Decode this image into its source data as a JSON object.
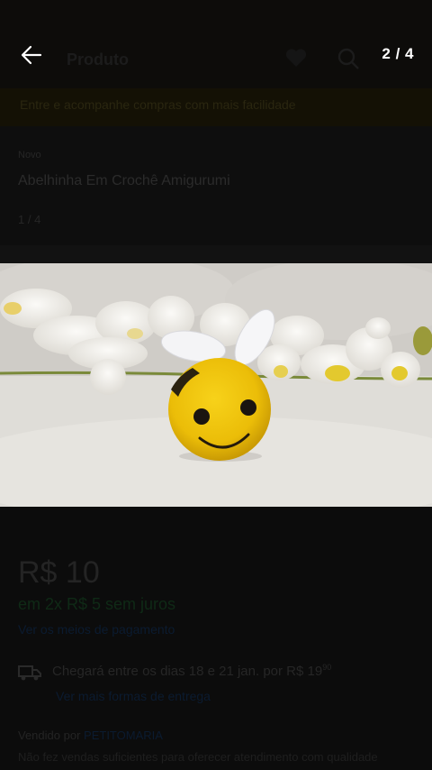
{
  "header": {
    "title": "Produto",
    "counter": "2 / 4",
    "back_icon": "arrow-left-icon",
    "favorite_icon": "heart-icon",
    "search_icon": "search-icon"
  },
  "banner": {
    "text": "Entre e acompanhe compras com mais facilidade"
  },
  "product": {
    "condition": "Novo",
    "name": "Abelhinha Em Crochê Amigurumi",
    "gallery_index": "1 / 4"
  },
  "pricing": {
    "price": "R$ 10",
    "installments": "em 2x R$ 5 sem juros",
    "payment_link": "Ver os meios de pagamento"
  },
  "shipping": {
    "icon": "truck-icon",
    "text": "Chegará entre os dias 18 e 21 jan. por R$ 19",
    "cents": "90",
    "link": "Ver mais formas de entrega"
  },
  "seller": {
    "label": "Vendido por",
    "name": "PETITOMARIA",
    "note": "Não fez vendas suficientes para oferecer atendimento com qualidade"
  },
  "colors": {
    "overlay_bg": "#0b0b0b",
    "counter_text": "#ffffff",
    "bee_yellow": "#f2c80c"
  }
}
